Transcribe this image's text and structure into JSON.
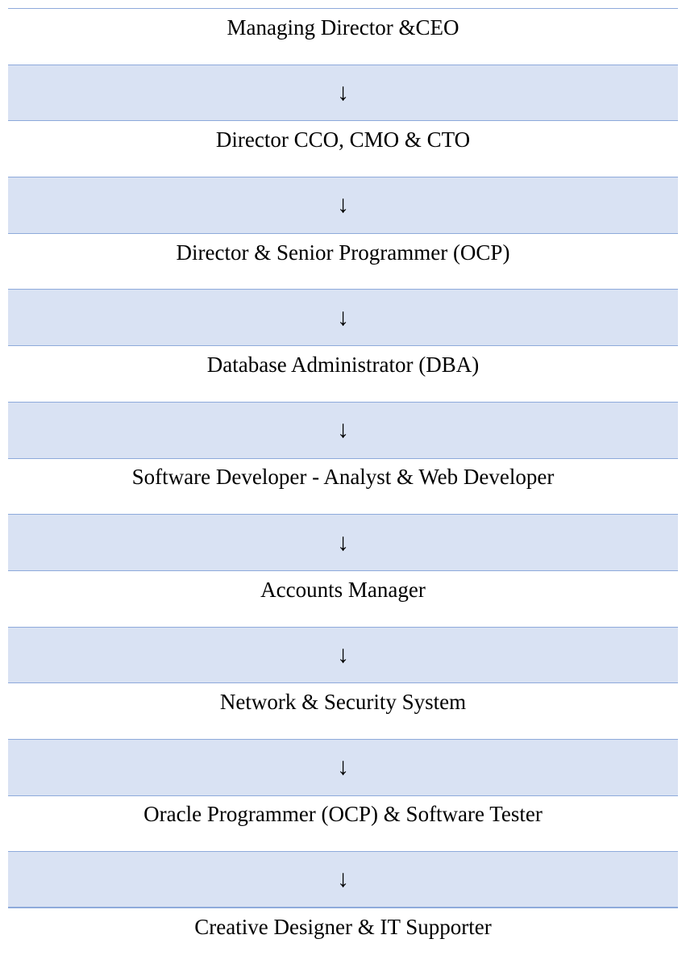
{
  "org_chart": {
    "arrow_symbol": "↓",
    "colors": {
      "connector_band": "#d9e2f3",
      "rule_line": "#8eaadb",
      "text": "#000000"
    },
    "roles": [
      "Managing Director &CEO",
      "Director CCO, CMO & CTO",
      "Director & Senior Programmer (OCP)",
      "Database Administrator (DBA)",
      "Software Developer - Analyst & Web Developer",
      "Accounts Manager",
      "Network & Security System",
      "Oracle Programmer (OCP) & Software Tester",
      "Creative Designer & IT Supporter"
    ]
  }
}
